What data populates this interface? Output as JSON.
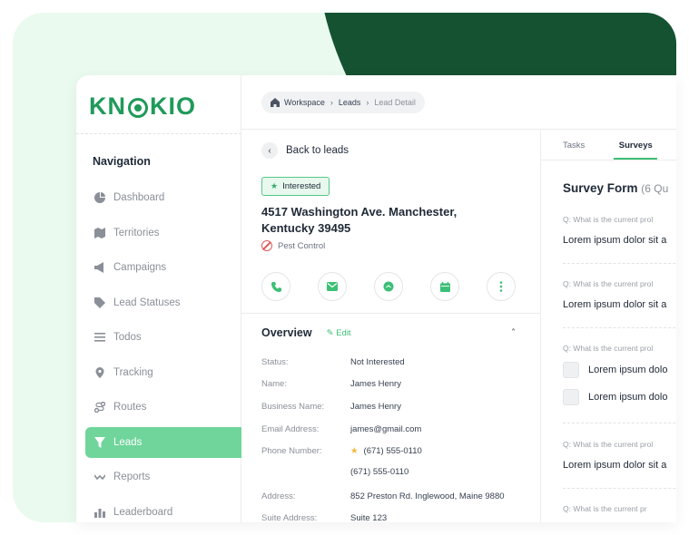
{
  "brand": {
    "logo_left": "KN",
    "logo_right": "KIO",
    "accent": "#3cbf76",
    "dark": "#155232"
  },
  "sidebar": {
    "heading": "Navigation",
    "items": [
      {
        "label": "Dashboard",
        "icon": "pie-chart-icon"
      },
      {
        "label": "Territories",
        "icon": "map-icon"
      },
      {
        "label": "Campaigns",
        "icon": "megaphone-icon"
      },
      {
        "label": "Lead Statuses",
        "icon": "tag-icon"
      },
      {
        "label": "Todos",
        "icon": "list-icon"
      },
      {
        "label": "Tracking",
        "icon": "location-pin-icon"
      },
      {
        "label": "Routes",
        "icon": "route-icon"
      },
      {
        "label": "Leads",
        "icon": "funnel-icon",
        "active": true
      },
      {
        "label": "Reports",
        "icon": "trend-icon"
      },
      {
        "label": "Leaderboard",
        "icon": "bar-chart-icon"
      }
    ]
  },
  "breadcrumb": {
    "home": "Workspace",
    "section": "Leads",
    "current": "Lead Detail"
  },
  "lead": {
    "back_label": "Back to leads",
    "status_badge": "Interested",
    "address_line1": "4517 Washington Ave. Manchester,",
    "address_line2": "Kentucky 39495",
    "category": "Pest Control"
  },
  "overview": {
    "title": "Overview",
    "edit_label": "Edit",
    "fields": [
      {
        "label": "Status:",
        "value": "Not Interested"
      },
      {
        "label": "Name:",
        "value": "James Henry"
      },
      {
        "label": "Business Name:",
        "value": "James Henry"
      },
      {
        "label": "Email Address:",
        "value": "james@gmail.com"
      },
      {
        "label": "Phone Number:",
        "value": "(671) 555-0110",
        "value2": "(671) 555-0110"
      },
      {
        "label": "Address:",
        "value": "852 Preston Rd. Inglewood, Maine 9880"
      },
      {
        "label": "Suite Address:",
        "value": "Suite 123"
      }
    ]
  },
  "tabs": {
    "tasks": "Tasks",
    "surveys": "Surveys"
  },
  "survey": {
    "title": "Survey Form",
    "count": "(6 Qu",
    "questions": [
      {
        "q": "Q: What is the current prol",
        "a": "Lorem ipsum dolor sit a"
      },
      {
        "q": "Q: What is the current prol",
        "a": "Lorem ipsum dolor sit a"
      },
      {
        "q": "Q: What is the current prol",
        "opt1": "Lorem ipsum dolo",
        "opt2": "Lorem ipsum dolo"
      },
      {
        "q": "Q: What is the current prol",
        "a": "Lorem ipsum dolor sit a"
      },
      {
        "q": "Q: What is the current pr"
      }
    ]
  }
}
